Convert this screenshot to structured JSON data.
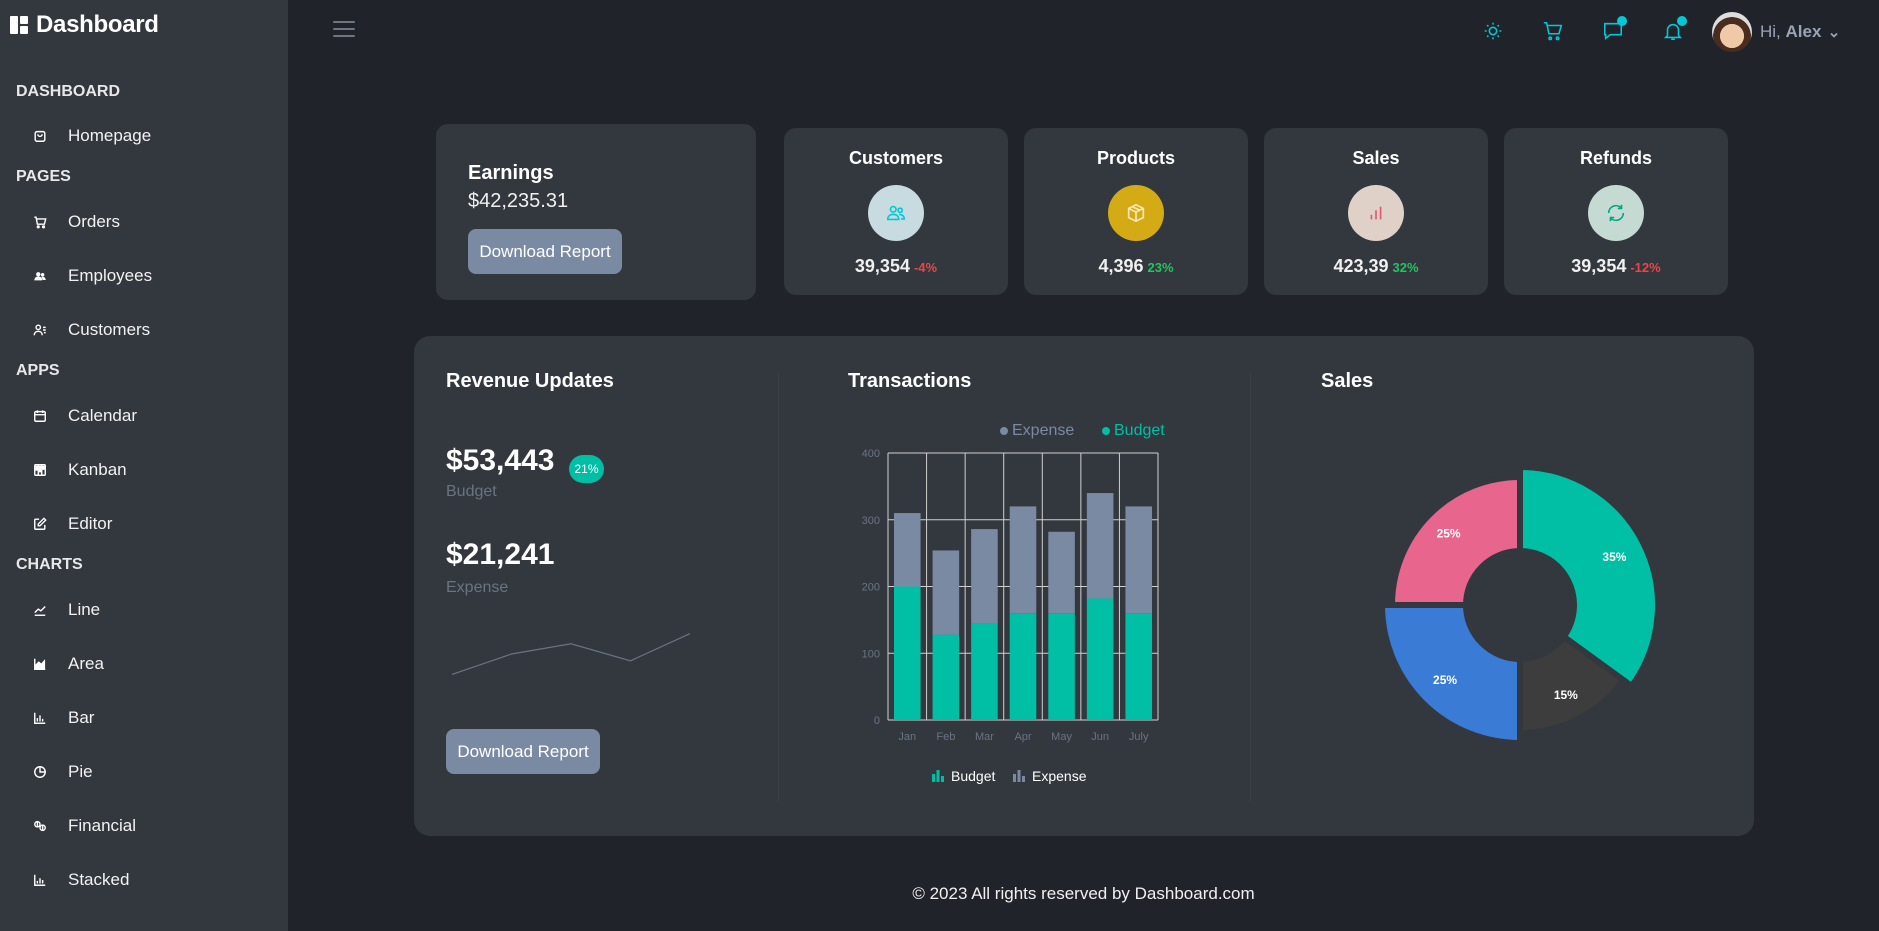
{
  "app": {
    "title": "Dashboard"
  },
  "sidebar": {
    "sections": [
      {
        "label": "DASHBOARD",
        "items": [
          {
            "label": "Homepage",
            "icon": "shopping-bag-icon"
          }
        ]
      },
      {
        "label": "PAGES",
        "items": [
          {
            "label": "Orders",
            "icon": "cart-icon"
          },
          {
            "label": "Employees",
            "icon": "users-icon"
          },
          {
            "label": "Customers",
            "icon": "user-list-icon"
          }
        ]
      },
      {
        "label": "APPS",
        "items": [
          {
            "label": "Calendar",
            "icon": "calendar-icon"
          },
          {
            "label": "Kanban",
            "icon": "kanban-icon"
          },
          {
            "label": "Editor",
            "icon": "edit-icon"
          }
        ]
      },
      {
        "label": "CHARTS",
        "items": [
          {
            "label": "Line",
            "icon": "line-chart-icon"
          },
          {
            "label": "Area",
            "icon": "area-chart-icon"
          },
          {
            "label": "Bar",
            "icon": "bar-chart-icon"
          },
          {
            "label": "Pie",
            "icon": "pie-chart-icon"
          },
          {
            "label": "Financial",
            "icon": "financial-icon"
          },
          {
            "label": "Stacked",
            "icon": "stacked-chart-icon"
          }
        ]
      }
    ]
  },
  "topbar": {
    "greeting": "Hi,",
    "user": "Alex",
    "accent": "#03c9d7"
  },
  "earnings": {
    "label": "Earnings",
    "value": "$42,235.31",
    "button": "Download Report"
  },
  "stats": [
    {
      "title": "Customers",
      "value": "39,354",
      "change": "-4%",
      "change_color": "#ef4444",
      "icon": "customers-icon",
      "icon_bg": "#c7dbe0",
      "icon_color": "#03c9d7"
    },
    {
      "title": "Products",
      "value": "4,396",
      "change": "23%",
      "change_color": "#22c55e",
      "icon": "box-icon",
      "icon_bg": "#d4ab15",
      "icon_color": "#f5e9b8"
    },
    {
      "title": "Sales",
      "value": "423,39",
      "change": "32%",
      "change_color": "#22c55e",
      "icon": "bar-chart-icon",
      "icon_bg": "#dfd1c8",
      "icon_color": "#e3596b"
    },
    {
      "title": "Refunds",
      "value": "39,354",
      "change": "-12%",
      "change_color": "#ef4444",
      "icon": "refresh-icon",
      "icon_bg": "#c5dad3",
      "icon_color": "#00a67e"
    }
  ],
  "revenue": {
    "title": "Revenue Updates",
    "budget_value": "$53,443",
    "budget_badge": "21%",
    "budget_label": "Budget",
    "expense_value": "$21,241",
    "expense_label": "Expense",
    "button": "Download Report"
  },
  "transactions": {
    "title": "Transactions",
    "legend_top": [
      "Expense",
      "Budget"
    ],
    "legend_bottom": [
      "Budget",
      "Expense"
    ]
  },
  "sales": {
    "title": "Sales"
  },
  "footer": {
    "text": "© 2023 All rights reserved by Dashboard.com"
  },
  "chart_data": [
    {
      "type": "line",
      "title": "",
      "x": [
        1,
        2,
        3,
        4,
        5
      ],
      "values": [
        2,
        5,
        6.5,
        4,
        8
      ],
      "color": "#6b7383"
    },
    {
      "type": "bar",
      "title": "Transactions",
      "stacked": true,
      "categories": [
        "Jan",
        "Feb",
        "Mar",
        "Apr",
        "May",
        "Jun",
        "July"
      ],
      "series": [
        {
          "name": "Budget",
          "values": [
            200,
            128,
            144,
            160,
            160,
            182,
            160
          ],
          "color": "#00bfa5"
        },
        {
          "name": "Expense",
          "values": [
            110,
            126,
            142,
            160,
            122,
            158,
            160
          ],
          "color": "#7b8aa3"
        }
      ],
      "ylim": [
        0,
        400
      ],
      "yticks": [
        0,
        100,
        200,
        300,
        400
      ],
      "grid": true,
      "legend": "top-right"
    },
    {
      "type": "pie",
      "title": "Sales",
      "donut": true,
      "slices": [
        {
          "label": "35%",
          "value": 35,
          "color": "#00bfa5"
        },
        {
          "label": "15%",
          "value": 15,
          "color": "#3d3d3d"
        },
        {
          "label": "25%",
          "value": 25,
          "color": "#3a7bd5"
        },
        {
          "label": "25%",
          "value": 25,
          "color": "#e8668e"
        }
      ]
    }
  ]
}
